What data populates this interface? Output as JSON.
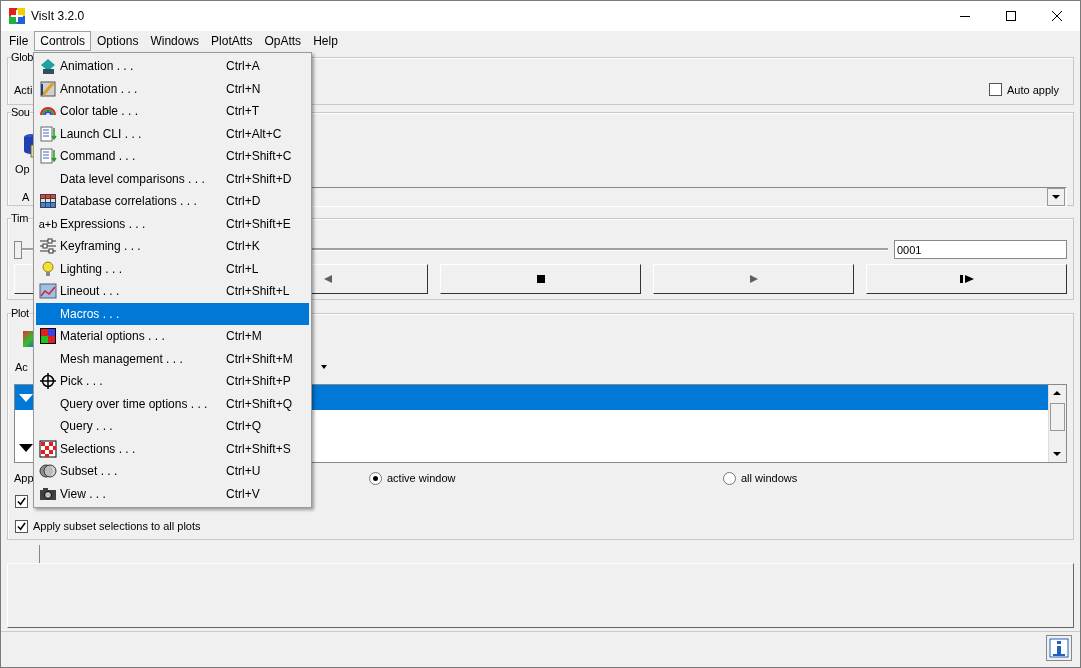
{
  "window": {
    "title": "VisIt 3.2.0"
  },
  "menubar": [
    {
      "label": "File",
      "selected": false
    },
    {
      "label": "Controls",
      "selected": true
    },
    {
      "label": "Options",
      "selected": false
    },
    {
      "label": "Windows",
      "selected": false
    },
    {
      "label": "PlotAtts",
      "selected": false
    },
    {
      "label": "OpAtts",
      "selected": false
    },
    {
      "label": "Help",
      "selected": false
    }
  ],
  "controls_menu": [
    {
      "label": "Animation . . .",
      "shortcut": "Ctrl+A",
      "kind": "animation",
      "selected": false
    },
    {
      "label": "Annotation . . .",
      "shortcut": "Ctrl+N",
      "kind": "annotation",
      "selected": false
    },
    {
      "label": "Color table . . .",
      "shortcut": "Ctrl+T",
      "kind": "colortable",
      "selected": false
    },
    {
      "label": "Launch CLI . . .",
      "shortcut": "Ctrl+Alt+C",
      "kind": "script",
      "selected": false
    },
    {
      "label": "Command . . .",
      "shortcut": "Ctrl+Shift+C",
      "kind": "script",
      "selected": false
    },
    {
      "label": "Data level comparisons . . .",
      "shortcut": "Ctrl+Shift+D",
      "kind": "none",
      "selected": false
    },
    {
      "label": "Database correlations . . .",
      "shortcut": "Ctrl+D",
      "kind": "grid",
      "selected": false
    },
    {
      "label": "Expressions . . .",
      "shortcut": "Ctrl+Shift+E",
      "kind": "text",
      "icon_text": "a+b",
      "selected": false
    },
    {
      "label": "Keyframing . . .",
      "shortcut": "Ctrl+K",
      "kind": "sliders",
      "selected": false
    },
    {
      "label": "Lighting . . .",
      "shortcut": "Ctrl+L",
      "kind": "bulb",
      "selected": false
    },
    {
      "label": "Lineout . . .",
      "shortcut": "Ctrl+Shift+L",
      "kind": "lineplot",
      "selected": false
    },
    {
      "label": "Macros . . .",
      "kind": "none",
      "selected": true
    },
    {
      "label": "Material options . . .",
      "shortcut": "Ctrl+M",
      "kind": "material",
      "selected": false
    },
    {
      "label": "Mesh management . . .",
      "shortcut": "Ctrl+Shift+M",
      "kind": "none",
      "selected": false
    },
    {
      "label": "Pick . . .",
      "shortcut": "Ctrl+Shift+P",
      "kind": "crosshair",
      "selected": false
    },
    {
      "label": "Query over time options . . .",
      "shortcut": "Ctrl+Shift+Q",
      "kind": "none",
      "selected": false
    },
    {
      "label": "Query . . .",
      "shortcut": "Ctrl+Q",
      "kind": "none",
      "selected": false
    },
    {
      "label": "Selections . . .",
      "shortcut": "Ctrl+Shift+S",
      "kind": "checker",
      "selected": false
    },
    {
      "label": "Subset . . .",
      "shortcut": "Ctrl+U",
      "kind": "circles",
      "selected": false
    },
    {
      "label": "View . . .",
      "shortcut": "Ctrl+V",
      "kind": "camera",
      "selected": false
    }
  ],
  "global": {
    "title": "Glob",
    "label": "Acti",
    "auto_apply": {
      "label": "Auto apply",
      "checked": false
    }
  },
  "sources": {
    "title": "Sou",
    "open_label": "Op",
    "label_3": "A"
  },
  "time": {
    "title": "Tim",
    "level": 0,
    "frame": "0001",
    "buttons": [
      {
        "kind": "hidden"
      },
      {
        "kind": "reverse"
      },
      {
        "kind": "stop"
      },
      {
        "kind": "play"
      },
      {
        "kind": "step"
      }
    ]
  },
  "plots": {
    "title": "Plot",
    "label": "Ac",
    "rows": [
      {
        "selected": true,
        "kind": "expandable"
      },
      {
        "selected": false,
        "kind": "plain"
      },
      {
        "selected": false,
        "kind": "expandable"
      }
    ],
    "apply_label": "App",
    "radios": [
      {
        "label": "active window",
        "selected": true
      },
      {
        "label": "all windows",
        "selected": false
      }
    ],
    "checkboxes": [
      {
        "checked": true
      },
      {
        "label": "Apply subset selections to all plots",
        "checked": true
      }
    ]
  }
}
